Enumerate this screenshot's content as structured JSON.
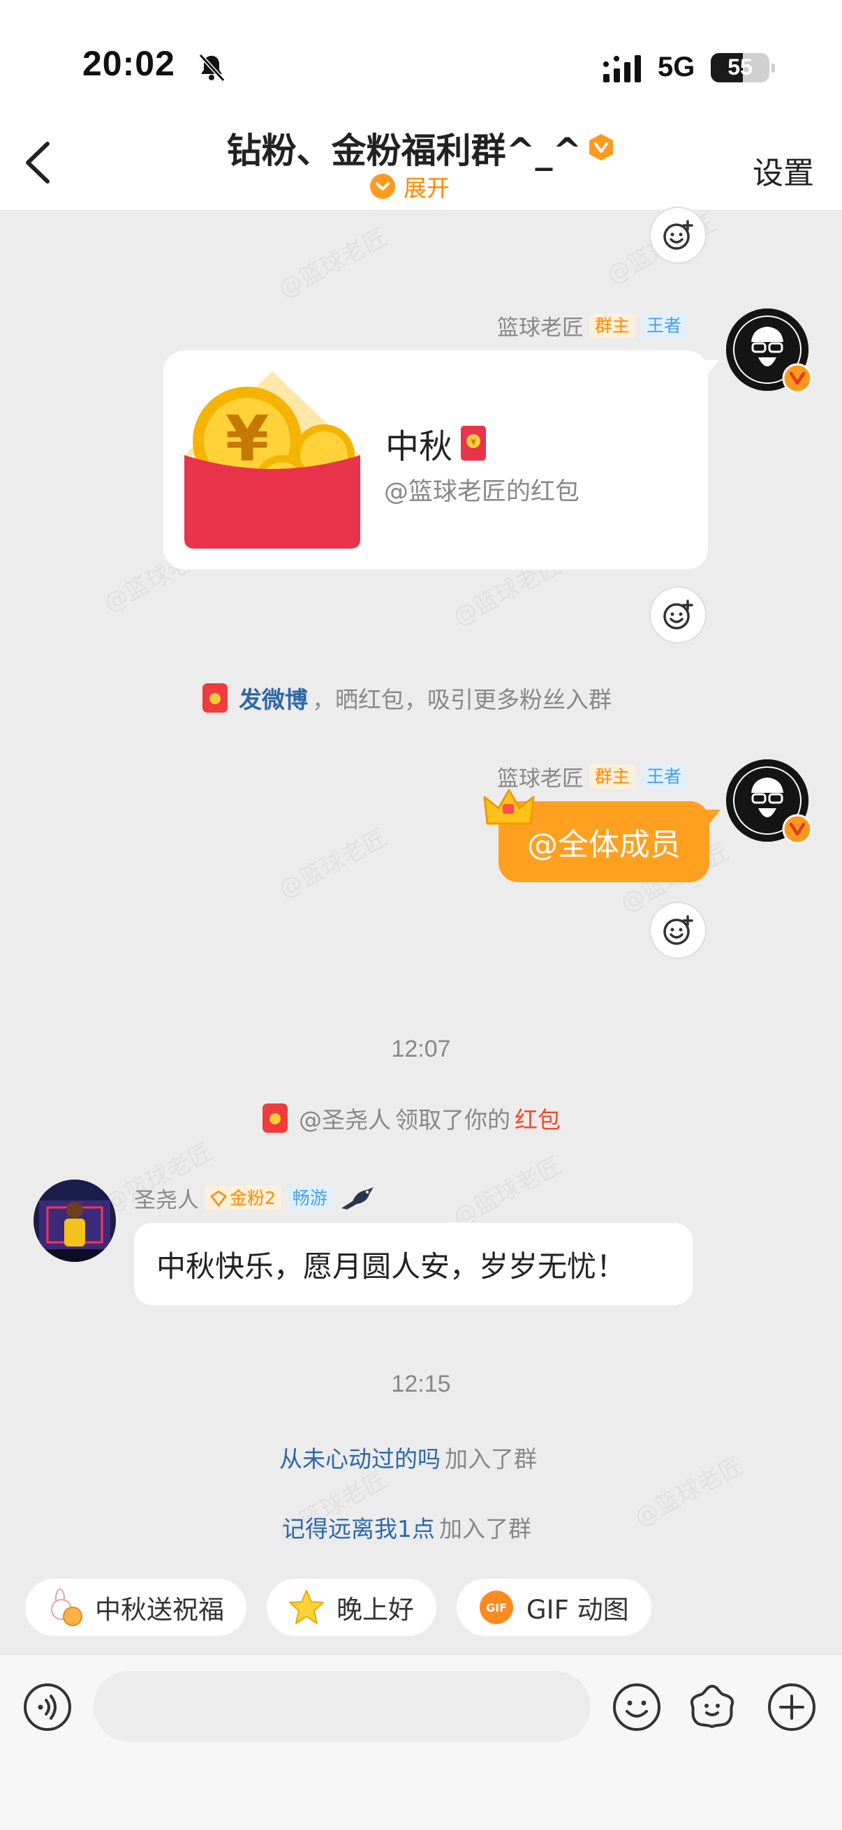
{
  "status": {
    "time": "20:02",
    "network": "5G",
    "battery": "55"
  },
  "header": {
    "title": "钻粉、金粉福利群^_^",
    "expand_label": "展开",
    "settings_label": "设置"
  },
  "watermark": "@篮球老匠",
  "messages": {
    "redpacket": {
      "sender": "篮球老匠",
      "tag_owner": "群主",
      "tag_rank": "王者",
      "title": "中秋",
      "subtitle": "@篮球老匠的红包"
    },
    "promo": {
      "link": "发微博",
      "text": "，晒红包，吸引更多粉丝入群"
    },
    "atall": {
      "sender": "篮球老匠",
      "tag_owner": "群主",
      "tag_rank": "王者",
      "text": "@全体成员"
    },
    "time1": "12:07",
    "claim": {
      "user": "@圣尧人",
      "middle": " 领取了你的",
      "red": "红包"
    },
    "greeting": {
      "sender": "圣尧人",
      "tag_fans": "金粉2",
      "tag_smooth": "畅游",
      "text": "中秋快乐，愿月圆人安，岁岁无忧！"
    },
    "time2": "12:15",
    "join1": {
      "user": "从未心动过的吗",
      "text": " 加入了群"
    },
    "join2": {
      "user": "记得远离我1点",
      "text": " 加入了群"
    }
  },
  "quick_replies": [
    "中秋送祝福",
    "晚上好",
    "GIF 动图"
  ],
  "colors": {
    "accent": "#ff9a1f",
    "link": "#2d68a8",
    "red": "#f04b2b",
    "background": "#ececec"
  }
}
